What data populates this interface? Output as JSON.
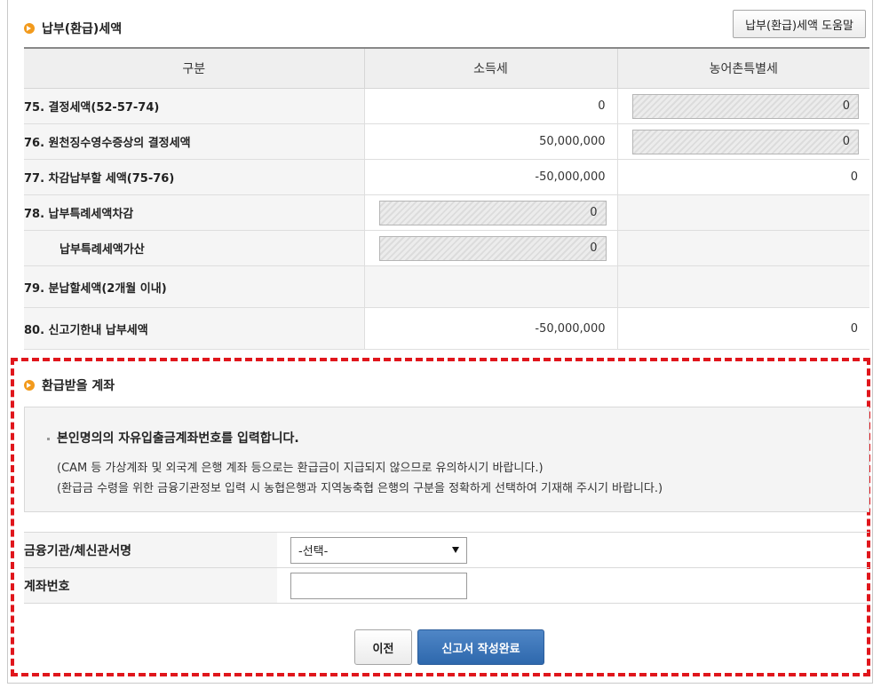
{
  "tax_section": {
    "title": "납부(환급)세액",
    "help_button": "납부(환급)세액 도움말",
    "columns": [
      "구분",
      "소득세",
      "농어촌특별세"
    ],
    "rows": [
      {
        "label": "75. 결정세액(52-57-74)",
        "income_tax": "0",
        "rural_tax": "0"
      },
      {
        "label": "76. 원천징수영수증상의 결정세액",
        "income_tax": "50,000,000",
        "rural_tax": "0"
      },
      {
        "label": "77. 차감납부할 세액(75-76)",
        "income_tax": "-50,000,000",
        "rural_tax": "0"
      },
      {
        "label": "78. 납부특례세액차감",
        "income_tax": "0",
        "rural_tax": ""
      },
      {
        "label": "납부특례세액가산",
        "income_tax": "0",
        "rural_tax": ""
      },
      {
        "label": "79. 분납할세액(2개월 이내)",
        "income_tax": "",
        "rural_tax": ""
      },
      {
        "label": "80. 신고기한내 납부세액",
        "income_tax": "-50,000,000",
        "rural_tax": "0"
      }
    ]
  },
  "refund_section": {
    "title": "환급받을 계좌",
    "notice_main": "본인명의의 자유입출금계좌번호를 입력합니다.",
    "notice_line1": "(CAM 등 가상계좌 및 외국계 은행 계좌 등으로는 환급금이 지급되지 않으므로 유의하시기 바랍니다.)",
    "notice_line2": "(환급금 수령을 위한 금융기관정보 입력 시 농협은행과 지역농축협 은행의 구분을 정확하게 선택하여 기재해 주시기 바랍니다.)",
    "bank_label": "금융기관/체신관서명",
    "bank_selected": "-선택-",
    "account_label": "계좌번호",
    "account_value": ""
  },
  "buttons": {
    "prev": "이전",
    "complete": "신고서 작성완료"
  },
  "colors": {
    "highlight_dashed": "#e0161c",
    "primary_button": "#2e68ad",
    "section_icon": "#f29a1c"
  }
}
